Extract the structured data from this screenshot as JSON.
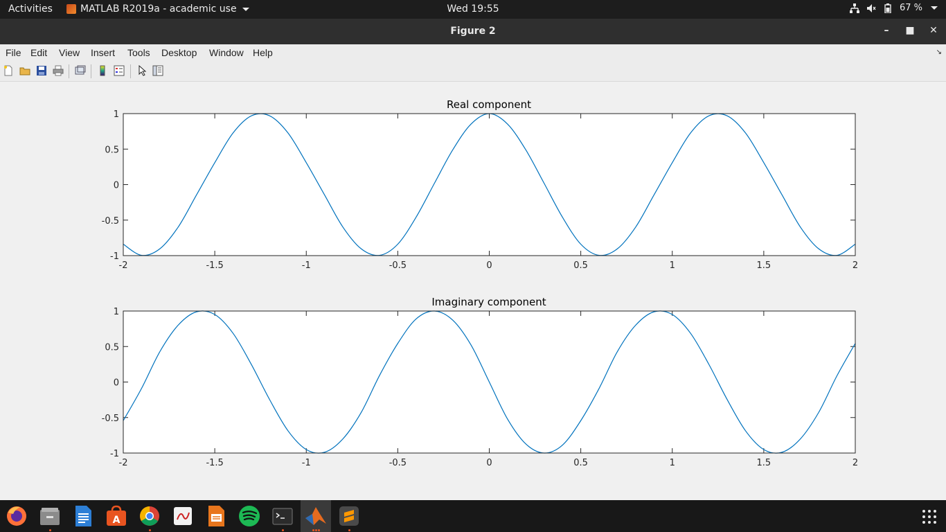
{
  "topbar": {
    "activities": "Activities",
    "app_name": "MATLAB R2019a - academic use",
    "clock": "Wed 19:55",
    "battery": "67 %"
  },
  "window": {
    "title": "Figure 2"
  },
  "menu": {
    "items": [
      "File",
      "Edit",
      "View",
      "Insert",
      "Tools",
      "Desktop",
      "Window",
      "Help"
    ]
  },
  "toolbar": {
    "icons": [
      "new-figure-icon",
      "open-file-icon",
      "save-icon",
      "print-icon",
      "link-plot-icon",
      "colorbar-icon",
      "legend-icon",
      "edit-plot-icon",
      "property-inspector-icon"
    ]
  },
  "chart_data": [
    {
      "type": "line",
      "title": "Real component",
      "xlim": [
        -2,
        2
      ],
      "ylim": [
        -1,
        1
      ],
      "xticks": [
        "-2",
        "-1.5",
        "-1",
        "-0.5",
        "0",
        "0.5",
        "1",
        "1.5",
        "2"
      ],
      "yticks": [
        "-1",
        "-0.5",
        "0",
        "0.5",
        "1"
      ],
      "color": "#0072bd",
      "series": [
        {
          "x": [
            -2.0,
            -1.9,
            -1.8,
            -1.7,
            -1.6,
            -1.5,
            -1.4,
            -1.3,
            -1.2,
            -1.1,
            -1.0,
            -0.9,
            -0.8,
            -0.7,
            -0.6,
            -0.5,
            -0.4,
            -0.3,
            -0.2,
            -0.1,
            0.0,
            0.1,
            0.2,
            0.3,
            0.4,
            0.5,
            0.6,
            0.7,
            0.8,
            0.9,
            1.0,
            1.1,
            1.2,
            1.3,
            1.4,
            1.5,
            1.6,
            1.7,
            1.8,
            1.9,
            2.0
          ],
          "y": [
            -0.839,
            -0.996,
            -0.904,
            -0.598,
            -0.146,
            0.309,
            0.728,
            0.969,
            0.969,
            0.728,
            0.309,
            -0.146,
            -0.598,
            -0.904,
            -0.996,
            -0.839,
            -0.459,
            0.017,
            0.488,
            0.852,
            1.0,
            0.852,
            0.488,
            0.017,
            -0.459,
            -0.839,
            -0.996,
            -0.904,
            -0.598,
            -0.146,
            0.309,
            0.728,
            0.969,
            0.969,
            0.728,
            0.309,
            -0.146,
            -0.598,
            -0.904,
            -0.996,
            -0.839
          ]
        }
      ]
    },
    {
      "type": "line",
      "title": "Imaginary component",
      "xlim": [
        -2,
        2
      ],
      "ylim": [
        -1,
        1
      ],
      "xticks": [
        "-2",
        "-1.5",
        "-1",
        "-0.5",
        "0",
        "0.5",
        "1",
        "1.5",
        "2"
      ],
      "yticks": [
        "-1",
        "-0.5",
        "0",
        "0.5",
        "1"
      ],
      "color": "#0072bd",
      "series": [
        {
          "x": [
            -2.0,
            -1.9,
            -1.8,
            -1.7,
            -1.6,
            -1.5,
            -1.4,
            -1.3,
            -1.2,
            -1.1,
            -1.0,
            -0.9,
            -0.8,
            -0.7,
            -0.6,
            -0.5,
            -0.4,
            -0.3,
            -0.2,
            -0.1,
            0.0,
            0.1,
            0.2,
            0.3,
            0.4,
            0.5,
            0.6,
            0.7,
            0.8,
            0.9,
            1.0,
            1.1,
            1.2,
            1.3,
            1.4,
            1.5,
            1.6,
            1.7,
            1.8,
            1.9,
            2.0
          ],
          "y": [
            -0.544,
            -0.089,
            0.428,
            0.801,
            0.989,
            0.951,
            0.686,
            0.247,
            -0.249,
            -0.686,
            -0.951,
            -0.989,
            -0.801,
            -0.429,
            0.091,
            0.544,
            0.888,
            1.0,
            0.873,
            0.523,
            0.0,
            -0.523,
            -0.873,
            -1.0,
            -0.888,
            -0.544,
            -0.091,
            0.429,
            0.801,
            0.989,
            0.951,
            0.686,
            0.249,
            -0.247,
            -0.686,
            -0.951,
            -0.989,
            -0.801,
            -0.428,
            0.089,
            0.544
          ]
        }
      ]
    }
  ],
  "dock": {
    "apps": [
      "firefox-icon",
      "files-icon",
      "writer-icon",
      "software-icon",
      "chrome-icon",
      "document-viewer-icon",
      "impress-icon",
      "spotify-icon",
      "terminal-icon",
      "matlab-icon",
      "sublime-icon"
    ]
  }
}
